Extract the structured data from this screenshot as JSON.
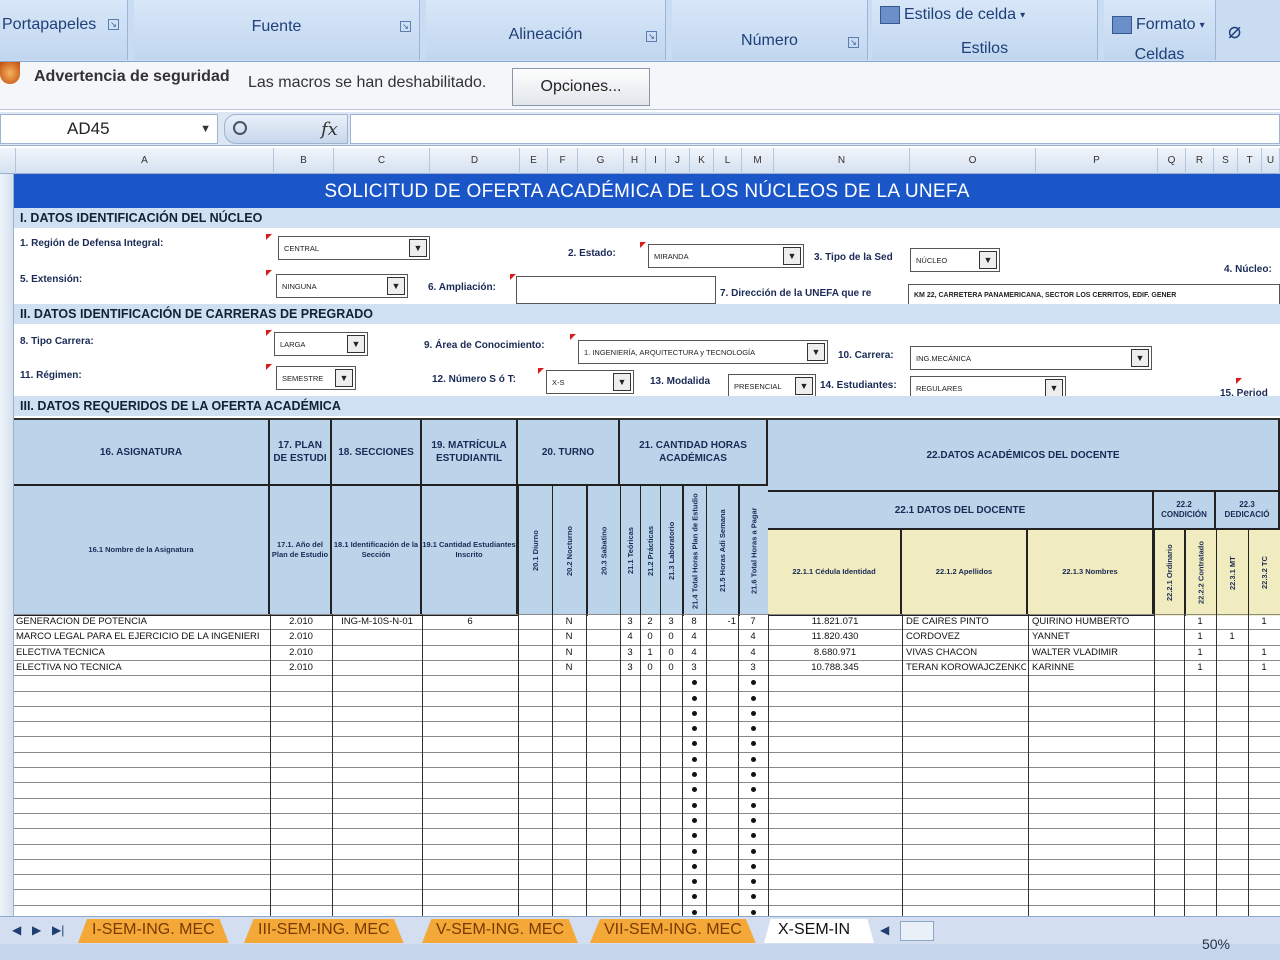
{
  "ribbon": {
    "groups": [
      "Portapapeles",
      "Fuente",
      "Alineación",
      "Número",
      "Estilos",
      "Celdas"
    ],
    "cell_styles_label": "Estilos de celda",
    "format_label": "Formato"
  },
  "security": {
    "title": "Advertencia de seguridad",
    "message": "Las macros se han deshabilitado.",
    "options_label": "Opciones..."
  },
  "formula_bar": {
    "name_box": "AD45",
    "fx": "fx",
    "value": ""
  },
  "columns": [
    "A",
    "B",
    "C",
    "D",
    "E",
    "F",
    "G",
    "H",
    "I",
    "J",
    "K",
    "L",
    "M",
    "N",
    "O",
    "P",
    "Q",
    "R",
    "S",
    "T",
    "U"
  ],
  "sheet": {
    "banner": "SOLICITUD DE OFERTA ACADÉMICA DE LOS NÚCLEOS DE LA UNEFA",
    "section1": "I. DATOS IDENTIFICACIÓN DEL NÚCLEO",
    "section2": "II. DATOS IDENTIFICACIÓN DE CARRERAS DE PREGRADO",
    "section3": "III. DATOS REQUERIDOS DE LA OFERTA ACADÉMICA",
    "fields": {
      "region_label": "1. Región de Defensa Integral:",
      "region_value": "CENTRAL",
      "estado_label": "2. Estado:",
      "estado_value": "MIRANDA",
      "tipo_sede_label": "3. Tipo de la Sed",
      "tipo_sede_value": "NÚCLEO",
      "nucleo_label": "4. Núcleo:",
      "extension_label": "5. Extensión:",
      "extension_value": "NINGUNA",
      "ampliacion_label": "6. Ampliación:",
      "ampliacion_value": "",
      "direccion_label": "7. Dirección de la UNEFA que re",
      "direccion_value": "KM 22, CARRETERA PANAMERICANA, SECTOR LOS CERRITOS, EDIF. GENER",
      "tipo_carrera_label": "8. Tipo Carrera:",
      "tipo_carrera_value": "LARGA",
      "area_label": "9. Área de Conocimiento:",
      "area_value": "1. INGENIERÍA, ARQUITECTURA y TECNOLOGÍA",
      "carrera_label": "10. Carrera:",
      "carrera_value": "ING.MECÁNICA",
      "regimen_label": "11. Régimen:",
      "regimen_value": "SEMESTRE",
      "numero_label": "12. Número S ó T:",
      "numero_value": "X-S",
      "modalidad_label": "13. Modalida",
      "modalidad_value": "PRESENCIAL",
      "estudiantes_label": "14. Estudiantes:",
      "estudiantes_value": "REGULARES",
      "periodo_label": "15. Period"
    },
    "headers": {
      "h16": "16. ASIGNATURA",
      "h17": "17. PLAN DE ESTUDI",
      "h18": "18. SECCIONES",
      "h19": "19. MATRÍCULA ESTUDIANTIL",
      "h20": "20. TURNO",
      "h21": "21. CANTIDAD HORAS ACADÉMICAS",
      "h22": "22.DATOS ACADÉMICOS DEL DOCENTE",
      "h16_1": "16.1 Nombre de la Asignatura",
      "h17_1": "17.1. Año del Plan de Estudio",
      "h18_1": "18.1 Identificación de la Sección",
      "h19_1": "19.1 Cantidad Estudiantes Inscrito",
      "h20_1": "20.1 Diurno",
      "h20_2": "20.2 Nocturno",
      "h20_3": "20.3 Sabatino",
      "h21_1": "21.1 Teóricas",
      "h21_2": "21.2 Prácticas",
      "h21_3": "21.3 Laboratorio",
      "h21_4": "21.4 Total Horas Plan de Estudio",
      "h21_5": "21.5 Horas Adi Semana",
      "h21_6": "21.6 Total Horas a Pagar",
      "h22_1": "22.1 DATOS DEL DOCENTE",
      "h22_1_1": "22.1.1 Cédula Identidad",
      "h22_1_2": "22.1.2 Apellidos",
      "h22_1_3": "22.1.3 Nombres",
      "h22_2": "22.2 CONDICIÓN",
      "h22_2_1": "22.2.1 Ordinario",
      "h22_2_2": "22.2.2 Contratado",
      "h22_3": "22.3 DEDICACIÓ",
      "h22_3_1": "22.3.1 MT",
      "h22_3_2": "22.3.2 TC"
    },
    "rows": [
      {
        "asignatura": "GENERACION DE POTENCIA",
        "plan": "2.010",
        "seccion": "ING-M-10S-N-01",
        "matricula": "6",
        "turno": "N",
        "teo": "3",
        "pra": "2",
        "lab": "3",
        "total": "8",
        "adi": "-1",
        "pagar": "7",
        "cedula": "11.821.071",
        "apellidos": "DE CAIRES PINTO",
        "nombres": "QUIRINO HUMBERTO",
        "ord": "",
        "con": "1",
        "mt": "",
        "tc": "1"
      },
      {
        "asignatura": "MARCO LEGAL PARA EL EJERCICIO DE LA INGENIERI",
        "plan": "2.010",
        "seccion": "",
        "matricula": "",
        "turno": "N",
        "teo": "4",
        "pra": "0",
        "lab": "0",
        "total": "4",
        "adi": "",
        "pagar": "4",
        "cedula": "11.820.430",
        "apellidos": "CORDOVEZ",
        "nombres": "YANNET",
        "ord": "",
        "con": "1",
        "mt": "1",
        "tc": ""
      },
      {
        "asignatura": "ELECTIVA TECNICA",
        "plan": "2.010",
        "seccion": "",
        "matricula": "",
        "turno": "N",
        "teo": "3",
        "pra": "1",
        "lab": "0",
        "total": "4",
        "adi": "",
        "pagar": "4",
        "cedula": "8.680.971",
        "apellidos": "VIVAS CHACON",
        "nombres": "WALTER VLADIMIR",
        "ord": "",
        "con": "1",
        "mt": "",
        "tc": "1"
      },
      {
        "asignatura": "ELECTIVA NO TECNICA",
        "plan": "2.010",
        "seccion": "",
        "matricula": "",
        "turno": "N",
        "teo": "3",
        "pra": "0",
        "lab": "0",
        "total": "3",
        "adi": "",
        "pagar": "3",
        "cedula": "10.788.345",
        "apellidos": "TERAN KOROWAJCZENKO",
        "nombres": "KARINNE",
        "ord": "",
        "con": "1",
        "mt": "",
        "tc": "1"
      }
    ]
  },
  "sheet_tabs": [
    "I-SEM-ING. MEC",
    "III-SEM-ING. MEC",
    "V-SEM-ING. MEC",
    "VII-SEM-ING. MEC",
    "X-SEM-IN"
  ],
  "zoom": "50%",
  "colors": {
    "banner": "#1a56c8",
    "tab": "#f3a838",
    "header": "#bcd4ea"
  }
}
